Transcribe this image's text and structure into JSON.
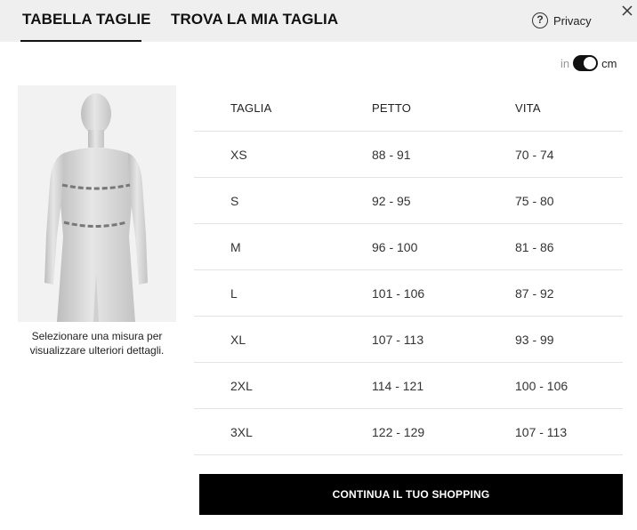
{
  "tabs": {
    "size_chart": "TABELLA TAGLIE",
    "find_my_size": "TROVA LA MIA TAGLIA"
  },
  "privacy": {
    "label": "Privacy",
    "icon": "question-circle-icon"
  },
  "close": {
    "icon": "close-icon"
  },
  "unit_toggle": {
    "left_label": "in",
    "right_label": "cm",
    "selected": "cm"
  },
  "figure": {
    "image": "mannequin-image",
    "caption": "Selezionare una misura per visualizzare ulteriori dettagli."
  },
  "table": {
    "headers": [
      "TAGLIA",
      "PETTO",
      "VITA"
    ],
    "rows": [
      [
        "XS",
        "88 - 91",
        "70 - 74"
      ],
      [
        "S",
        "92 - 95",
        "75 - 80"
      ],
      [
        "M",
        "96 - 100",
        "81 - 86"
      ],
      [
        "L",
        "101 - 106",
        "87 - 92"
      ],
      [
        "XL",
        "107 - 113",
        "93 - 99"
      ],
      [
        "2XL",
        "114 - 121",
        "100 - 106"
      ],
      [
        "3XL",
        "122 - 129",
        "107 - 113"
      ]
    ]
  },
  "cta": {
    "label": "CONTINUA IL TUO SHOPPING"
  },
  "colors": {
    "header_bg": "#efefef",
    "button_bg": "#000000",
    "figure_bg": "#f2f2f2"
  }
}
